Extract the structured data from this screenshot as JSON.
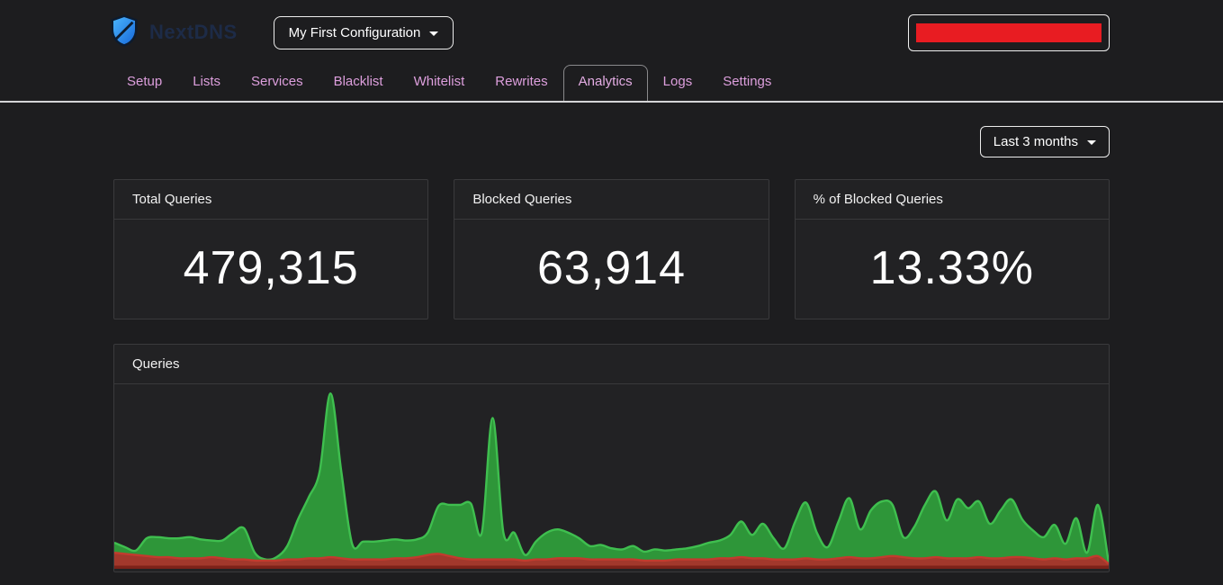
{
  "header": {
    "brand": "NextDNS",
    "config_selector": {
      "label": "My First Configuration"
    },
    "account_button": {
      "note": "content redacted with red block"
    }
  },
  "tabs": [
    {
      "label": "Setup",
      "active": false
    },
    {
      "label": "Lists",
      "active": false
    },
    {
      "label": "Services",
      "active": false
    },
    {
      "label": "Blacklist",
      "active": false
    },
    {
      "label": "Whitelist",
      "active": false
    },
    {
      "label": "Rewrites",
      "active": false
    },
    {
      "label": "Analytics",
      "active": true
    },
    {
      "label": "Logs",
      "active": false
    },
    {
      "label": "Settings",
      "active": false
    }
  ],
  "period_selector": {
    "label": "Last 3 months"
  },
  "stats": [
    {
      "title": "Total Queries",
      "value": "479,315"
    },
    {
      "title": "Blocked Queries",
      "value": "63,914"
    },
    {
      "title": "% of Blocked Queries",
      "value": "13.33%"
    }
  ],
  "chart_card": {
    "title": "Queries"
  },
  "theme": {
    "tab_color": "#dd9fdd",
    "redaction_color": "#e81c22",
    "separator_color": "#d4d4d6",
    "card_bg": "#222224",
    "page_bg": "#1d1d1f"
  },
  "chart_data": {
    "type": "area",
    "title": "Queries",
    "xlabel": "days over last 3 months (oldest on left, no axis labels shown)",
    "ylabel": "queries per day (no axis shown, estimated from peak heights)",
    "ylim": [
      0,
      32000
    ],
    "grid": false,
    "legend": "none",
    "stacked_visual": "green total-queries area with red blocked-queries band along the bottom",
    "series": [
      {
        "name": "Total Queries",
        "fill": "#2e9639",
        "stroke": "#3fbf4f",
        "values": [
          4200,
          3400,
          2800,
          5000,
          5200,
          5000,
          5000,
          5200,
          4800,
          4600,
          4600,
          6000,
          6800,
          2400,
          1200,
          1600,
          3600,
          8400,
          12400,
          17000,
          31000,
          17000,
          4000,
          4400,
          4400,
          4600,
          4800,
          4600,
          4800,
          6000,
          10800,
          11000,
          11000,
          11200,
          6000,
          26600,
          6000,
          6000,
          2000,
          4400,
          6000,
          6600,
          6000,
          5000,
          3600,
          3800,
          3200,
          3000,
          3600,
          2600,
          3000,
          2800,
          3000,
          3200,
          3600,
          4200,
          4600,
          5600,
          8000,
          5600,
          7600,
          5000,
          3200,
          8000,
          11400,
          6000,
          3400,
          8000,
          12200,
          6600,
          10000,
          11600,
          11000,
          5200,
          7000,
          11000,
          13400,
          8200,
          12000,
          10400,
          11600,
          7600,
          10000,
          12000,
          8400,
          6400,
          5200,
          7400,
          4000,
          8600,
          2400,
          11000,
          600
        ]
      },
      {
        "name": "Blocked Queries",
        "fill": "#a2382c",
        "stroke": "#c23b2e",
        "values": [
          2400,
          2200,
          2000,
          1800,
          1600,
          1600,
          1400,
          1400,
          1400,
          1600,
          1400,
          1200,
          1200,
          1000,
          1000,
          1000,
          1200,
          1200,
          1400,
          1400,
          1600,
          1400,
          1200,
          1200,
          1200,
          1200,
          1400,
          1400,
          1600,
          2000,
          2200,
          1800,
          1400,
          1200,
          1200,
          1200,
          1200,
          1200,
          1000,
          1200,
          1200,
          1400,
          1400,
          1400,
          1200,
          1200,
          1200,
          1200,
          1200,
          1000,
          1000,
          1000,
          1200,
          1200,
          1200,
          1200,
          1400,
          1400,
          1600,
          1400,
          1400,
          1200,
          1200,
          1200,
          1400,
          1200,
          1200,
          1400,
          1600,
          1400,
          1400,
          1600,
          1800,
          1600,
          1400,
          1400,
          1600,
          1400,
          1400,
          1400,
          1600,
          1400,
          1400,
          1600,
          1600,
          1400,
          1200,
          1400,
          1200,
          1400,
          1400,
          1800,
          400
        ]
      }
    ],
    "bottom_edge_color": "#7c2219"
  }
}
